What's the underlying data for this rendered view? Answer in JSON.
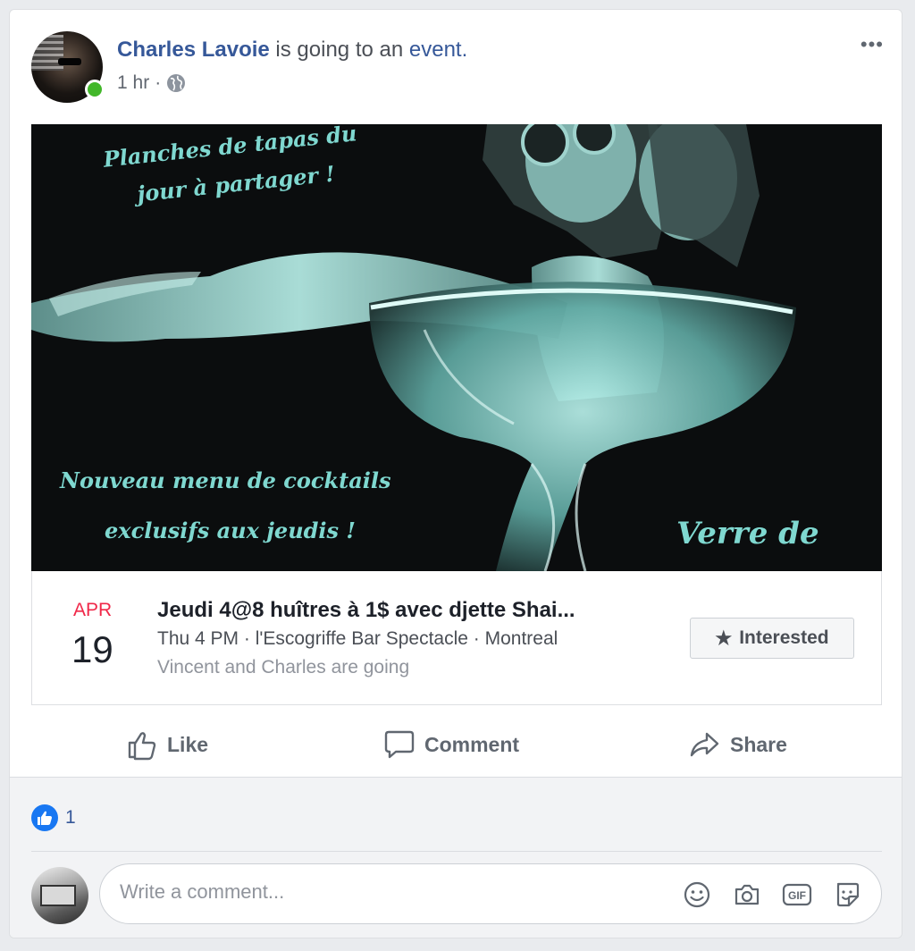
{
  "post": {
    "author": "Charles Lavoie",
    "verb": "is going to an",
    "event_link": "event.",
    "time": "1 hr",
    "meta_sep": "·",
    "more": "•••"
  },
  "hero": {
    "top_line1": "Planches de tapas du",
    "top_line2": "jour à partager !",
    "bottom_line1": "Nouveau menu de cocktails",
    "bottom_line2": "exclusifs aux jeudis !",
    "bottom_right": "Verre de"
  },
  "event": {
    "month": "APR",
    "day": "19",
    "title": "Jeudi 4@8 huîtres à 1$ avec djette Shai...",
    "when": "Thu 4 PM · l'Escogriffe Bar Spectacle · Montreal",
    "going": "Vincent and Charles are going",
    "interested_star": "★",
    "interested_label": "Interested"
  },
  "actions": {
    "like": "Like",
    "comment": "Comment",
    "share": "Share"
  },
  "reactions": {
    "count": "1"
  },
  "comment": {
    "placeholder": "Write a comment...",
    "gif_label": "GIF"
  },
  "colors": {
    "link": "#365899",
    "online": "#42b72a",
    "month": "#f02849",
    "like_badge": "#1877f2"
  }
}
